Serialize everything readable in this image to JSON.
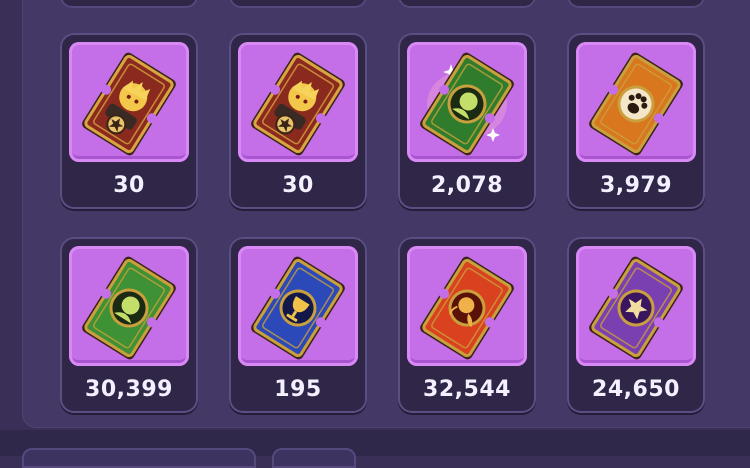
{
  "inventory": {
    "items": [
      {
        "name": "hero-ticket-blonde-a",
        "count": "30",
        "icon": "hero-card-icon",
        "colors": {
          "card": "#8a2a1e",
          "frame": "#d9a441",
          "emblem": "#e9c46a"
        }
      },
      {
        "name": "hero-ticket-blonde-b",
        "count": "30",
        "icon": "hero-card-icon",
        "colors": {
          "card": "#8a2a1e",
          "frame": "#d9a441",
          "emblem": "#e9c46a"
        }
      },
      {
        "name": "green-summon-ticket-sparkle",
        "count": "2,078",
        "icon": "green-head-ticket-icon",
        "colors": {
          "card": "#2f7d2c",
          "frame": "#c9a03d",
          "emblem": "#c3df6a"
        }
      },
      {
        "name": "orange-paw-ticket",
        "count": "3,979",
        "icon": "paw-ticket-icon",
        "colors": {
          "card": "#d9771f",
          "frame": "#c9a03d",
          "emblem": "#2b1a10"
        }
      },
      {
        "name": "green-summon-ticket",
        "count": "30,399",
        "icon": "green-head-ticket-icon",
        "colors": {
          "card": "#3e9134",
          "frame": "#c9a03d",
          "emblem": "#c3df6a"
        }
      },
      {
        "name": "blue-chalice-ticket",
        "count": "195",
        "icon": "chalice-ticket-icon",
        "colors": {
          "card": "#2b49b8",
          "frame": "#c9a03d",
          "emblem": "#f1c24a"
        }
      },
      {
        "name": "red-rose-ticket",
        "count": "32,544",
        "icon": "rose-ticket-icon",
        "colors": {
          "card": "#d9411f",
          "frame": "#c9a03d",
          "emblem": "#f1b14a"
        }
      },
      {
        "name": "purple-star-ticket",
        "count": "24,650",
        "icon": "star-ticket-icon",
        "colors": {
          "card": "#7a3fb0",
          "frame": "#c9a03d",
          "emblem": "#f3dca0"
        }
      }
    ]
  },
  "theme": {
    "panel": "#433866",
    "slot": "#2f2648",
    "icon_bg": "#c46ee8",
    "text": "#f4f0ff"
  }
}
